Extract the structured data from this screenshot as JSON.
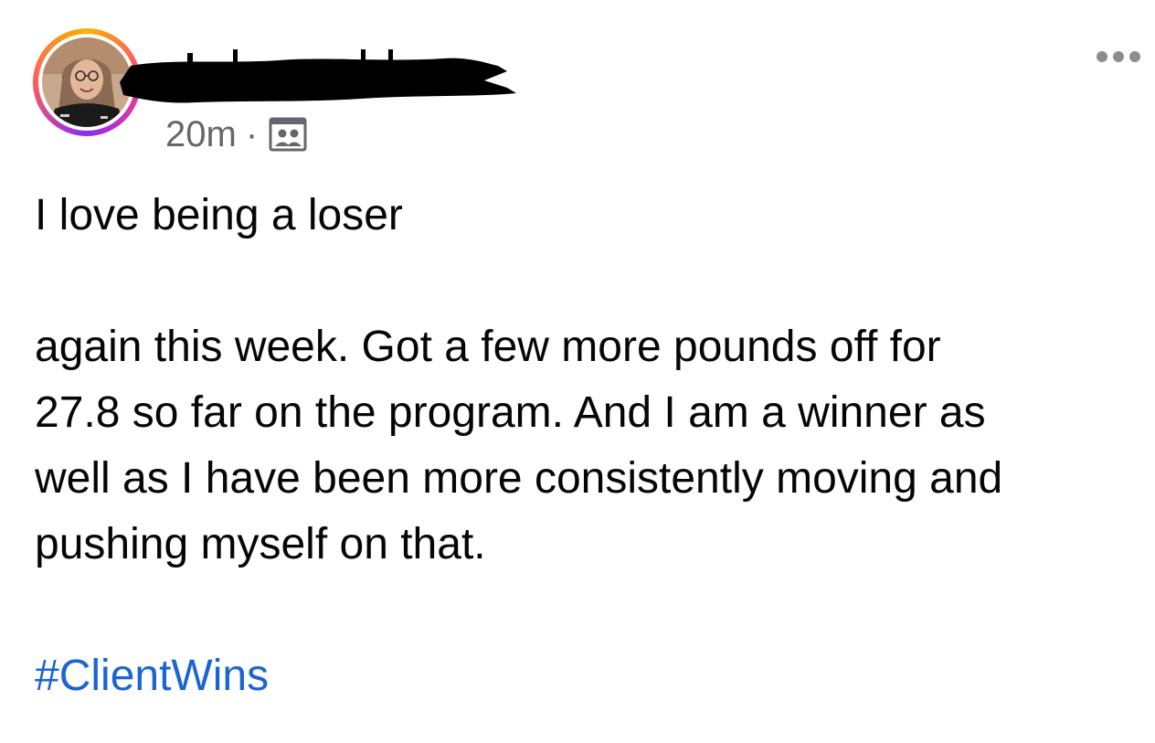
{
  "post": {
    "timestamp": "20m",
    "separator": "·",
    "audience_icon": "group-audience-icon",
    "more_icon": "more-options-icon",
    "text_lines_first": "I love being a loser",
    "text_lines": [
      "again this week. Got a few more pounds off for",
      "27.8 so far on the program. And I am a winner as",
      "well as I have been more consistently moving and",
      "pushing myself on that."
    ],
    "hashtag": "#ClientWins"
  },
  "colors": {
    "meta_text": "#65676b",
    "body_text": "#050505",
    "hashtag": "#1a64d4",
    "redaction": "#000000"
  }
}
